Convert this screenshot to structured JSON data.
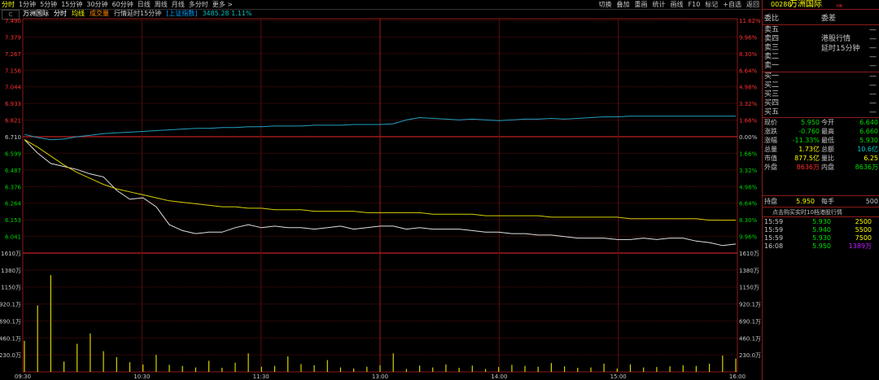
{
  "toolbar": {
    "tabs": [
      "分时",
      "1分钟",
      "5分钟",
      "15分钟",
      "30分钟",
      "60分钟",
      "日线",
      "周线",
      "月线",
      "多分时",
      "更多 >"
    ],
    "tools": [
      "切换",
      "叠加",
      "重画",
      "统计",
      "画线",
      "F10",
      "标记",
      "+自选",
      "返回"
    ]
  },
  "infobar": {
    "icon": "C",
    "name": "万洲国际",
    "items": [
      "分时",
      "均线",
      "成交量",
      "行情延时15分钟",
      "[上证指数]",
      "3485.28 1.11%"
    ]
  },
  "chart_data": {
    "type": "line",
    "price_axis_left": [
      "7.490",
      "7.379",
      "7.267",
      "7.156",
      "7.044",
      "6.933",
      "6.821",
      "6.710",
      "6.599",
      "6.487",
      "6.376",
      "6.264",
      "6.153",
      "6.041"
    ],
    "pct_axis_right": [
      "11.62%",
      "9.96%",
      "8.30%",
      "6.64%",
      "4.98%",
      "3.32%",
      "1.66%",
      "0.00%",
      "1.66%",
      "3.32%",
      "4.98%",
      "6.64%",
      "8.30%",
      "9.96%"
    ],
    "volume_axis": [
      "1610万",
      "1380万",
      "1150万",
      "920.1万",
      "690.1万",
      "460.1万",
      "230.0万"
    ],
    "time_axis": [
      "09:30",
      "10:30",
      "11:30",
      "13:00",
      "14:00",
      "15:00",
      "16:00"
    ],
    "series": [
      {
        "values": [
          6.69,
          6.6,
          6.53,
          6.51,
          6.49,
          6.46,
          6.44,
          6.35,
          6.29,
          6.3,
          6.24,
          6.12,
          6.08,
          6.06,
          6.07,
          6.07,
          6.1,
          6.12,
          6.1,
          6.11,
          6.1,
          6.1,
          6.09,
          6.1,
          6.11,
          6.09,
          6.1,
          6.11,
          6.11,
          6.09,
          6.1,
          6.09,
          6.09,
          6.09,
          6.08,
          6.07,
          6.07,
          6.06,
          6.06,
          6.05,
          6.05,
          6.04,
          6.03,
          6.03,
          6.03,
          6.02,
          6.02,
          6.03,
          6.02,
          6.03,
          6.03,
          6.01,
          6.0,
          5.98,
          5.99
        ]
      },
      {
        "values": [
          6.69,
          6.64,
          6.58,
          6.52,
          6.47,
          6.43,
          6.39,
          6.36,
          6.34,
          6.32,
          6.3,
          6.28,
          6.27,
          6.26,
          6.25,
          6.24,
          6.24,
          6.23,
          6.23,
          6.22,
          6.22,
          6.22,
          6.21,
          6.21,
          6.21,
          6.21,
          6.2,
          6.2,
          6.2,
          6.2,
          6.2,
          6.19,
          6.19,
          6.19,
          6.19,
          6.18,
          6.18,
          6.18,
          6.18,
          6.18,
          6.17,
          6.17,
          6.17,
          6.17,
          6.17,
          6.17,
          6.16,
          6.16,
          6.16,
          6.16,
          6.16,
          6.16,
          6.15,
          6.15,
          6.15
        ]
      },
      {
        "values": [
          3486,
          3482,
          3479,
          3480,
          3483,
          3485,
          3487,
          3488,
          3489,
          3490,
          3491,
          3492,
          3493,
          3494,
          3494,
          3495,
          3495,
          3496,
          3496,
          3497,
          3497,
          3497,
          3498,
          3498,
          3498,
          3499,
          3499,
          3499,
          3500,
          3505,
          3508,
          3507,
          3506,
          3505,
          3506,
          3505,
          3504,
          3505,
          3506,
          3506,
          3507,
          3506,
          3507,
          3508,
          3509,
          3509,
          3510,
          3510,
          3510,
          3510,
          3510,
          3510,
          3510,
          3510,
          3510
        ]
      }
    ],
    "volumes": [
      420,
      900,
      1310,
      140,
      380,
      520,
      280,
      200,
      130,
      100,
      230,
      95,
      80,
      60,
      150,
      55,
      125,
      250,
      70,
      80,
      210,
      105,
      90,
      160,
      60,
      45,
      70,
      90,
      250,
      40,
      85,
      60,
      100,
      55,
      85,
      40,
      65,
      95,
      80,
      70,
      120,
      75,
      55,
      60,
      110,
      45,
      100,
      60,
      65,
      75,
      90,
      80,
      110,
      220,
      180
    ]
  },
  "panel": {
    "code": "00288",
    "name": "万洲国际",
    "tag": "HK",
    "header_left": "委比",
    "header_right": "委差",
    "asks": [
      "卖五",
      "卖四",
      "卖三",
      "卖二",
      "卖一"
    ],
    "bids": [
      "买一",
      "买二",
      "买三",
      "买四",
      "买五"
    ],
    "dash": "—",
    "note_line1": "港股行情",
    "note_line2": "延时15分钟",
    "stats": [
      [
        "现价",
        "5.950",
        "今开",
        "6.640"
      ],
      [
        "涨跌",
        "-0.760",
        "最高",
        "6.660"
      ],
      [
        "涨幅",
        "-11.33%",
        "最低",
        "5.930"
      ],
      [
        "总量",
        "1.73亿",
        "总额",
        "10.6亿"
      ],
      [
        "市值",
        "877.5亿",
        "量比",
        "6.25"
      ],
      [
        "外盘",
        "8636万",
        "内盘",
        "8636万"
      ]
    ],
    "hold": [
      "持盘",
      "5.950",
      "每手",
      "500"
    ],
    "ticks_title": "点击购买实时10档港股行情",
    "ticks": [
      [
        "15:59",
        "5.930",
        "2500"
      ],
      [
        "15:59",
        "5.940",
        "5500"
      ],
      [
        "15:59",
        "5.930",
        "7500"
      ],
      [
        "16:08",
        "5.950",
        "1389万"
      ]
    ]
  }
}
